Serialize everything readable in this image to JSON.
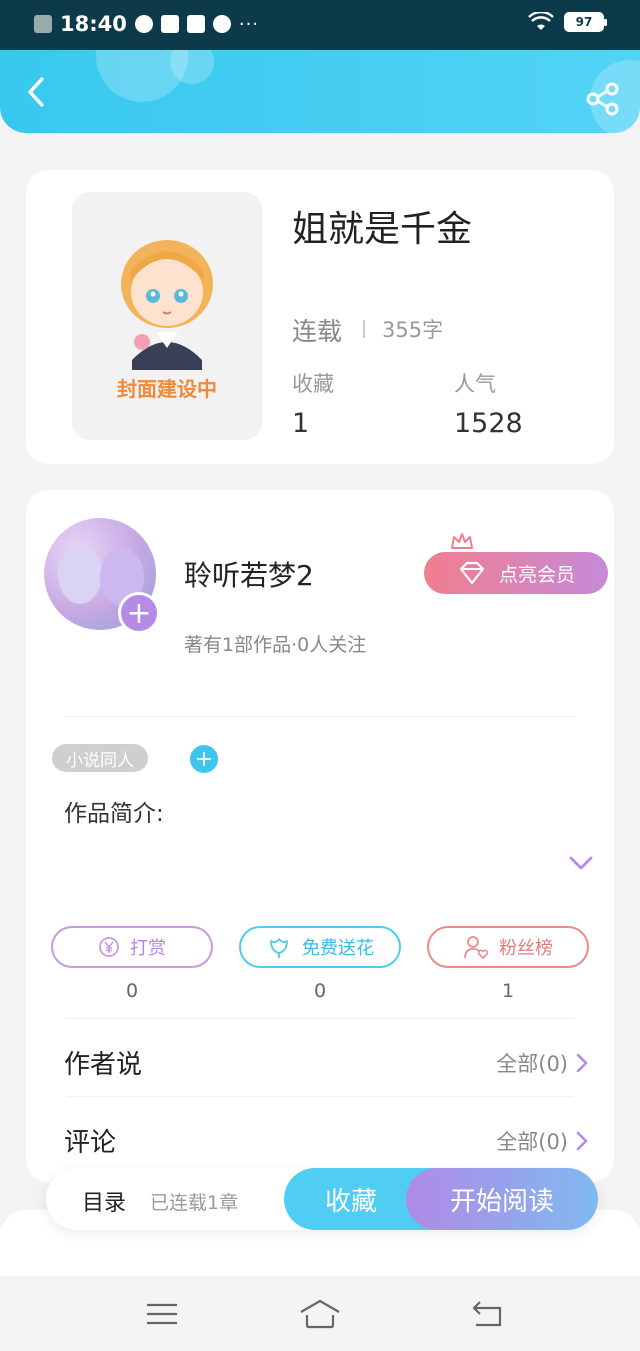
{
  "status_bar": {
    "time": "18:40",
    "more": "···",
    "battery": "97"
  },
  "header": {
    "back_icon": "chevron-left-icon",
    "share_icon": "share-icon"
  },
  "book": {
    "cover_caption": "封面建设中",
    "title": "姐就是千金",
    "status": "连载",
    "word_count": "355字",
    "favorites_label": "收藏",
    "favorites_value": "1",
    "popularity_label": "人气",
    "popularity_value": "1528"
  },
  "author": {
    "name": "聆听若梦2",
    "meta": "著有1部作品·0人关注",
    "vip_label": "点亮会员",
    "follow_plus": "+"
  },
  "tags": {
    "tag": "小说同人",
    "add": "+"
  },
  "intro": {
    "label": "作品简介:"
  },
  "actions": [
    {
      "label": "打赏",
      "count": "0",
      "color": "#c79be0",
      "icon": "yen-icon"
    },
    {
      "label": "免费送花",
      "count": "0",
      "color": "#4fcdec",
      "icon": "flower-icon"
    },
    {
      "label": "粉丝榜",
      "count": "1",
      "color": "#ec8a8a",
      "icon": "fan-user-icon"
    }
  ],
  "author_says": {
    "title": "作者说",
    "link": "全部(0)"
  },
  "comments": {
    "title": "评论",
    "link": "全部(0)"
  },
  "bottom_bar": {
    "toc": "目录",
    "serial_info": "已连载1章",
    "collect": "收藏",
    "read": "开始阅读"
  },
  "colors": {
    "accent": "#4fcdf2",
    "purple": "#b68ae6",
    "header": "#38c8ee"
  }
}
